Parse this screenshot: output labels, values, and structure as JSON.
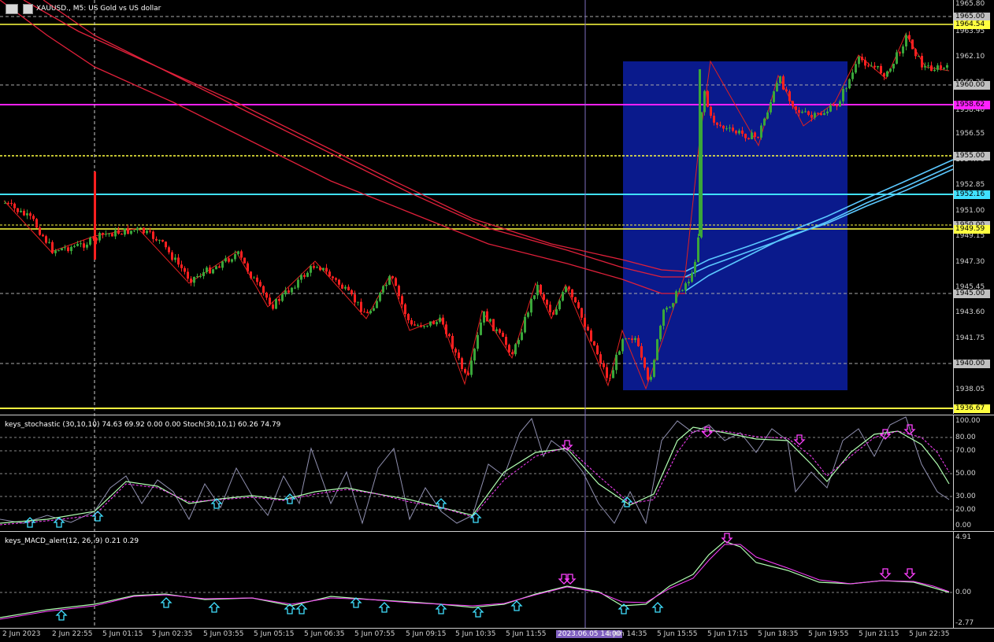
{
  "header": {
    "title": "XAUUSD., M5:  US Gold vs US dollar"
  },
  "colors": {
    "up_candle": "#3aa63a",
    "down_candle": "#ff2020",
    "ma": "#e0203a",
    "ma_fast": "#5bc8ff",
    "box": "#0a1a8c",
    "yellow_level": "#ffff40",
    "magenta_level": "#ff20ff",
    "cyan_level": "#40e0ff"
  },
  "price_axis": {
    "ticks": [
      "1965.80",
      "1963.95",
      "1962.10",
      "1960.25",
      "1958.40",
      "1956.55",
      "1954.70",
      "1952.85",
      "1951.00",
      "1949.15",
      "1947.30",
      "1945.45",
      "1943.60",
      "1941.75",
      "1939.90",
      "1938.05"
    ],
    "levels": [
      {
        "label": "1965.00",
        "bg": "#c0c0c0"
      },
      {
        "label": "1964.54",
        "bg": "#ffff40"
      },
      {
        "label": "1960.00",
        "bg": "#c0c0c0"
      },
      {
        "label": "1958.62",
        "bg": "#ff20ff"
      },
      {
        "label": "1955.00",
        "bg": "#c0c0c0"
      },
      {
        "label": "1952.16",
        "bg": "#40e0ff"
      },
      {
        "label": "1950.00",
        "bg": "#c0c0c0"
      },
      {
        "label": "1949.59",
        "bg": "#ffff40"
      },
      {
        "label": "1945.00",
        "bg": "#c0c0c0"
      },
      {
        "label": "1940.00",
        "bg": "#c0c0c0"
      },
      {
        "label": "1936.67",
        "bg": "#ffff40"
      }
    ]
  },
  "stochastic": {
    "title": "keys_stochastic (30,10,10) 74.63 69.92 0.00 0.00 Stoch(30,10,1) 60.26 74.79",
    "ticks": [
      "100.00",
      "80.00",
      "70.00",
      "50.00",
      "30.00",
      "20.00",
      "0.00"
    ]
  },
  "macd": {
    "title": "keys_MACD_alert(12, 26, 9) 0.21 0.29",
    "ticks": [
      "4.91",
      "0.00",
      "-2.77"
    ]
  },
  "time_axis": {
    "labels": [
      "2 Jun 2023",
      "2 Jun 22:55",
      "5 Jun 01:15",
      "5 Jun 02:35",
      "5 Jun 03:55",
      "5 Jun 05:15",
      "5 Jun 06:35",
      "5 Jun 07:55",
      "5 Jun 09:15",
      "5 Jun 10:35",
      "5 Jun 11:55",
      "2023.06.05 14:00",
      "5 Jun 14:35",
      "5 Jun 15:55",
      "5 Jun 17:15",
      "5 Jun 18:35",
      "5 Jun 19:55",
      "5 Jun 21:15",
      "5 Jun 22:35"
    ],
    "crosshair_label": "2023.06.05 14:00"
  }
}
